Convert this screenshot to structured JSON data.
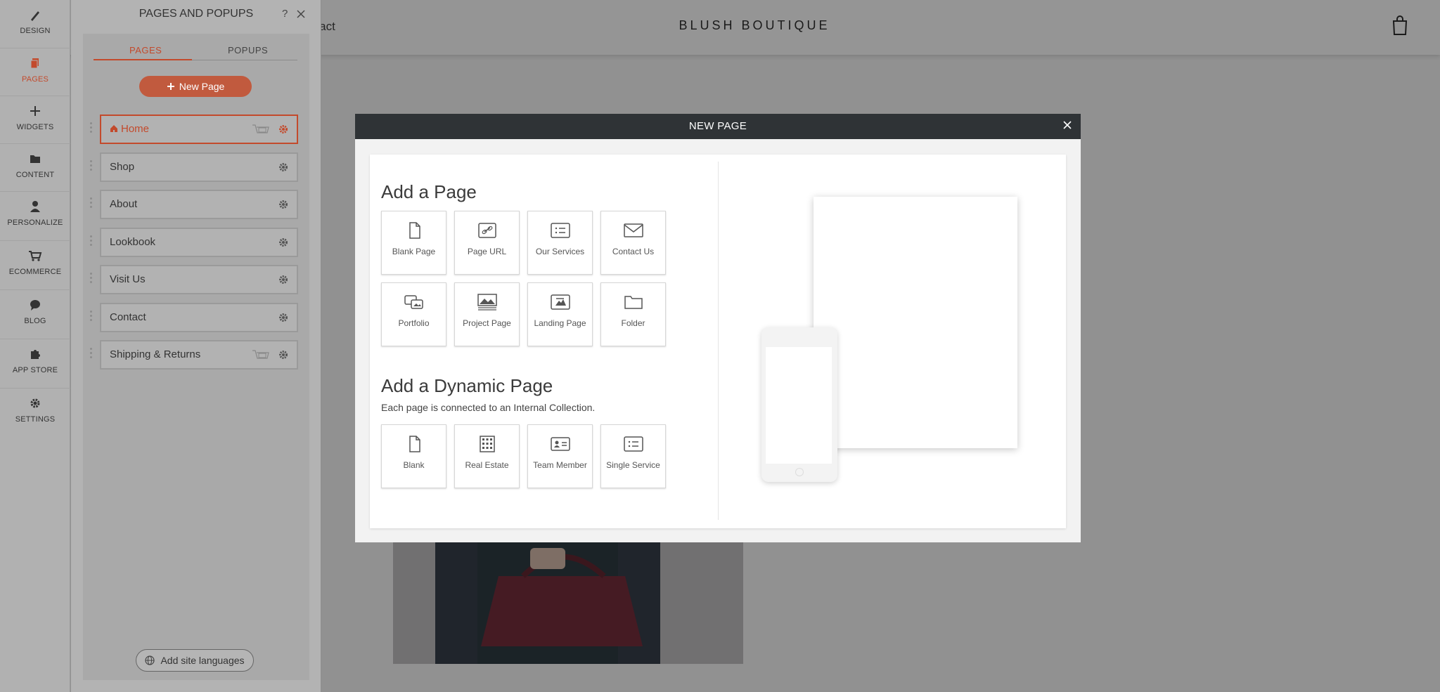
{
  "site": {
    "nav_fragment": "ntact",
    "brand": "BLUSH BOUTIQUE"
  },
  "rail": {
    "items": [
      {
        "label": "DESIGN",
        "icon": "brush-icon"
      },
      {
        "label": "PAGES",
        "icon": "pages-icon",
        "active": true
      },
      {
        "label": "WIDGETS",
        "icon": "plus-icon"
      },
      {
        "label": "CONTENT",
        "icon": "folder-icon"
      },
      {
        "label": "PERSONALIZE",
        "icon": "person-icon"
      },
      {
        "label": "ECOMMERCE",
        "icon": "cart-icon"
      },
      {
        "label": "BLOG",
        "icon": "chat-icon"
      },
      {
        "label": "APP STORE",
        "icon": "puzzle-icon"
      },
      {
        "label": "SETTINGS",
        "icon": "gear-icon"
      }
    ]
  },
  "panel": {
    "title": "PAGES AND POPUPS",
    "help": "?",
    "tabs": [
      "PAGES",
      "POPUPS"
    ],
    "new_page_label": "New Page",
    "pages": [
      "Home",
      "Shop",
      "About",
      "Lookbook",
      "Visit Us",
      "Contact",
      "Shipping & Returns"
    ],
    "languages_label": "Add site languages"
  },
  "modal": {
    "title": "NEW PAGE",
    "section1_title": "Add a Page",
    "pages": [
      "Blank Page",
      "Page URL",
      "Our Services",
      "Contact Us",
      "Portfolio",
      "Project Page",
      "Landing Page",
      "Folder"
    ],
    "section2_title": "Add a Dynamic Page",
    "section2_sub": "Each page is connected to an Internal Collection.",
    "dynamic": [
      "Blank",
      "Real Estate",
      "Team Member",
      "Single Service"
    ]
  },
  "colors": {
    "accent": "#c34a2c",
    "modal_header": "#2f3336"
  }
}
